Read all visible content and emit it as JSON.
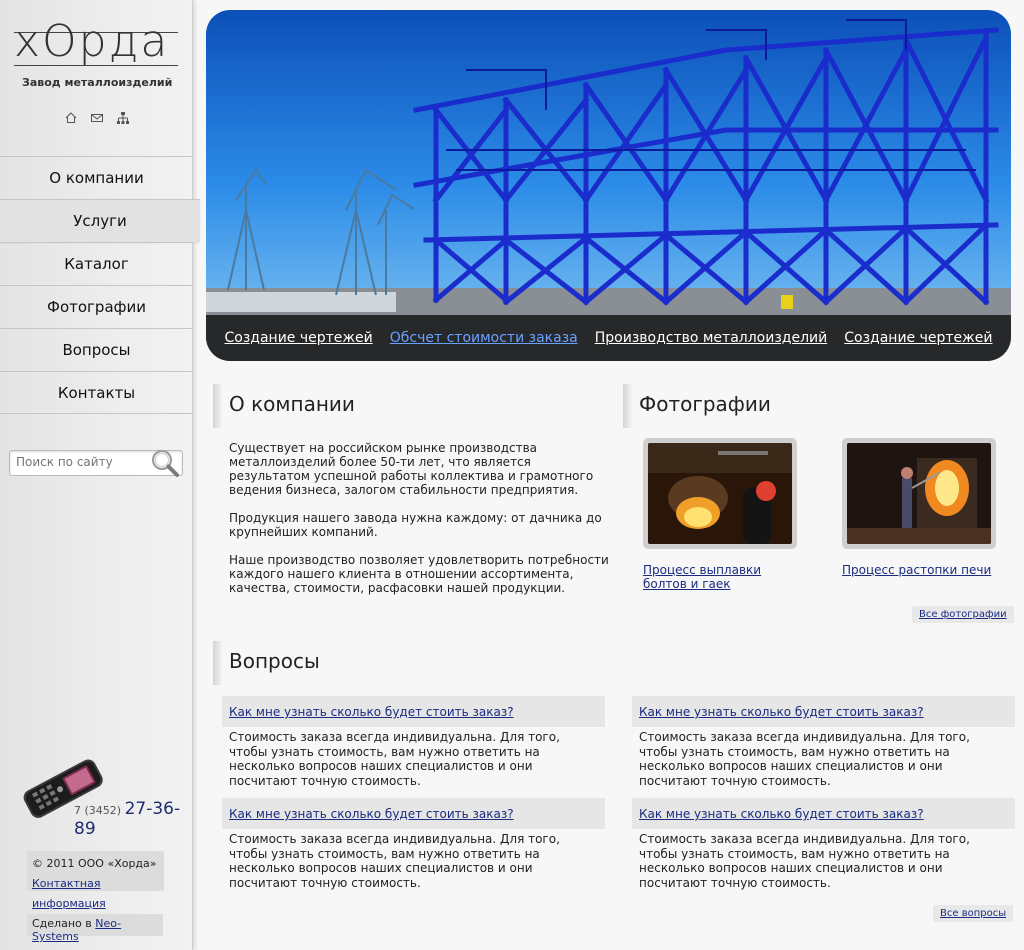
{
  "sidebar": {
    "logo_text": "хОрда",
    "logo_subtitle": "Завод металлоизделий",
    "top_icons": [
      "home-icon",
      "mail-icon",
      "sitemap-icon"
    ],
    "menu": [
      {
        "label": "О компании"
      },
      {
        "label": "Услуги"
      },
      {
        "label": "Каталог"
      },
      {
        "label": "Фотографии"
      },
      {
        "label": "Вопросы"
      },
      {
        "label": "Контакты"
      }
    ],
    "active_index": 1,
    "search_placeholder": "Поиск по сайту",
    "phone_code": "7 (3452)",
    "phone_number": "27-36-89",
    "copyright": "© 2011 ООО «Хорда»",
    "contact_link": "Контактная информация",
    "made_label": "Сделано в",
    "made_link": "Neo-Systems"
  },
  "banner": {
    "links": [
      "Создание чертежей",
      "Обсчет стоимости заказа",
      "Производство металлоизделий",
      "Создание чертежей"
    ],
    "hover_index": 1
  },
  "about": {
    "title": "О компании",
    "paragraphs": [
      "Существует на российском рынке производства металлоизделий более 50-ти лет, что является результатом успешной работы коллектива и грамотного ведения бизнеса, залогом стабильности предприятия.",
      "Продукция нашего завода нужна каждому: от дачника до крупнейших компаний.",
      "Наше производство позволяет удовлетворить потребности каждого нашего клиента  в отношении ассортимента, качества, стоимости, расфасовки нашей продукции."
    ]
  },
  "photos": {
    "title": "Фотографии",
    "items": [
      {
        "caption": "Процесс выплавки болтов и гаек"
      },
      {
        "caption": "Процесс растопки печи"
      }
    ],
    "all_label": "Все фотографии"
  },
  "faq": {
    "title": "Вопросы",
    "items": [
      {
        "q": "Как мне узнать сколько будет стоить заказ?",
        "a": "Стоимость заказа всегда индивидуальна. Для того, чтобы узнать стоимость, вам нужно ответить на несколько вопросов наших специалистов и они посчитают точную стоимость."
      },
      {
        "q": "Как мне узнать сколько будет стоить заказ?",
        "a": "Стоимость заказа всегда индивидуальна. Для того, чтобы узнать стоимость, вам нужно ответить на несколько вопросов наших специалистов и они посчитают точную стоимость."
      },
      {
        "q": "Как мне узнать сколько будет стоить заказ?",
        "a": "Стоимость заказа всегда индивидуальна. Для того, чтобы узнать стоимость, вам нужно ответить на несколько вопросов наших специалистов и они посчитают точную стоимость."
      },
      {
        "q": "Как мне узнать сколько будет стоить заказ?",
        "a": "Стоимость заказа всегда индивидуальна. Для того, чтобы узнать стоимость, вам нужно ответить на несколько вопросов наших специалистов и они посчитают точную стоимость."
      }
    ],
    "all_label": "Все вопросы"
  },
  "colors": {
    "accent_link": "#1a2b80",
    "banner_sky": "#1f7de0",
    "steel": "#1a2ccc"
  }
}
